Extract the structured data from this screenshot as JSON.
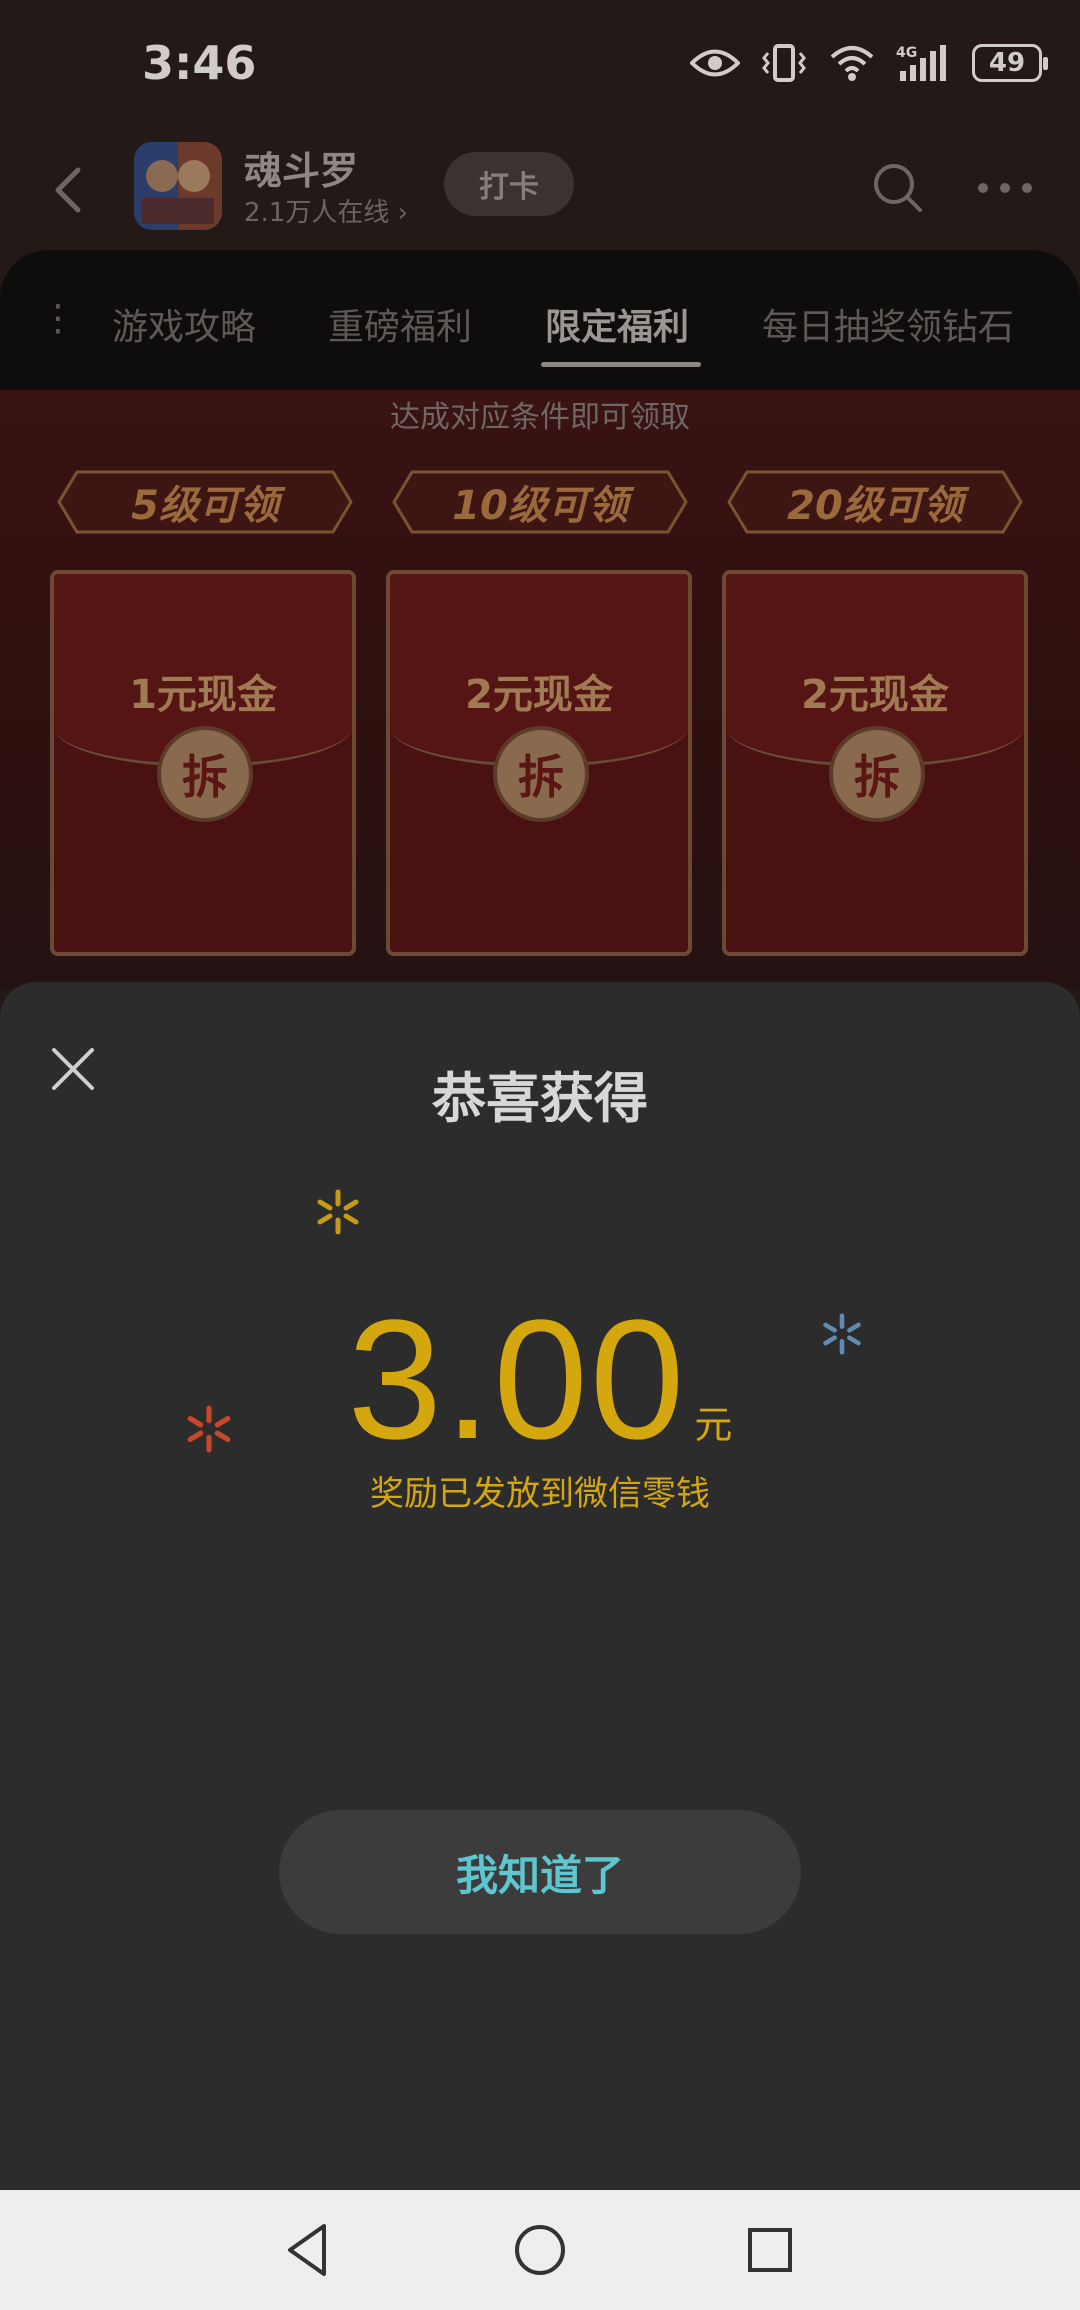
{
  "status_bar": {
    "time": "3:46",
    "battery": "49"
  },
  "header": {
    "game_name": "魂斗罗",
    "online_count": "2.1万人在线",
    "checkin_label": "打卡"
  },
  "tabs": [
    {
      "label": "游戏攻略"
    },
    {
      "label": "重磅福利"
    },
    {
      "label": "限定福利"
    },
    {
      "label": "每日抽奖领钻石"
    }
  ],
  "promo": {
    "hint": "达成对应条件即可领取",
    "rewards": [
      {
        "level": "5级可领",
        "title": "1元现金",
        "open": "拆"
      },
      {
        "level": "10级可领",
        "title": "2元现金",
        "open": "拆"
      },
      {
        "level": "20级可领",
        "title": "2元现金",
        "open": "拆"
      }
    ]
  },
  "modal": {
    "title": "恭喜获得",
    "amount": "3.00",
    "unit": "元",
    "note": "奖励已发放到微信零钱",
    "confirm_label": "我知道了"
  },
  "colors": {
    "gold": "#d4a70f",
    "teal": "#5ec6cf",
    "modal_bg": "#2c2c2c",
    "sparkle_orange": "#c8462a",
    "sparkle_blue": "#5f8cb0"
  }
}
